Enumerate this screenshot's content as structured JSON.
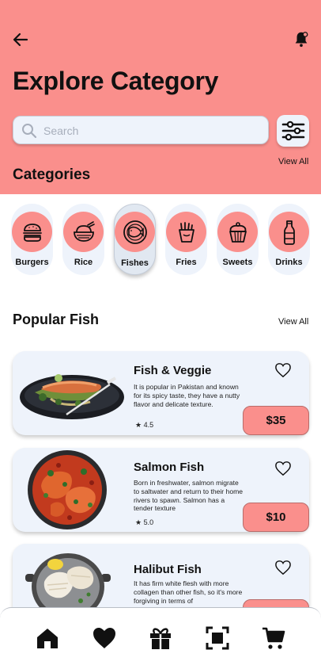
{
  "header": {
    "title": "Explore Category"
  },
  "search": {
    "placeholder": "Search"
  },
  "categories_section": {
    "title": "Categories",
    "view_all": "View All",
    "items": [
      {
        "label": "Burgers",
        "icon": "burger-icon",
        "active": false
      },
      {
        "label": "Rice",
        "icon": "rice-bowl-icon",
        "active": false
      },
      {
        "label": "Fishes",
        "icon": "fish-plate-icon",
        "active": true
      },
      {
        "label": "Fries",
        "icon": "fries-icon",
        "active": false
      },
      {
        "label": "Sweets",
        "icon": "cupcake-icon",
        "active": false
      },
      {
        "label": "Drinks",
        "icon": "bottle-icon",
        "active": false
      }
    ]
  },
  "popular": {
    "title": "Popular Fish",
    "view_all": "View All",
    "items": [
      {
        "name": "Fish & Veggie",
        "description": "It is popular in Pakistan and known for its spicy taste, they have a nutty flavor and delicate texture.",
        "rating": "4.5",
        "price": "$35"
      },
      {
        "name": "Salmon Fish",
        "description": "Born in freshwater, salmon migrate to saltwater and return to their home rivers to spawn. Salmon has a tender texture",
        "rating": "5.0",
        "price": "$10"
      },
      {
        "name": "Halibut Fish",
        "description": "It has firm white flesh with more collagen than other fish, so it's more forgiving in terms of",
        "rating": "",
        "price": ""
      }
    ]
  },
  "bottom_nav": [
    "home-icon",
    "heart-icon",
    "gift-icon",
    "scan-icon",
    "cart-icon"
  ],
  "colors": {
    "accent": "#fa8f8c",
    "surface": "#eef3fb",
    "text": "#111111"
  }
}
